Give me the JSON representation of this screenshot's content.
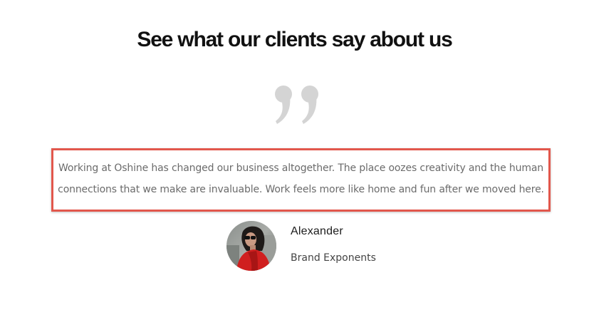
{
  "section": {
    "title": "See what our clients say about us"
  },
  "testimonial": {
    "line1": "Working at Oshine has changed our business altogether. The place oozes creativity and the human",
    "line2": "connections that we make are invaluable. Work feels more like home and fun after we moved here.",
    "author_name": "Alexander",
    "author_company": "Brand Exponents"
  },
  "icons": {
    "quote": "quote-icon",
    "avatar": "avatar"
  },
  "colors": {
    "highlight_border": "#e2574c",
    "quote_mark": "#d4d4d4",
    "title": "#111111",
    "body_text": "#6b6b6b"
  }
}
